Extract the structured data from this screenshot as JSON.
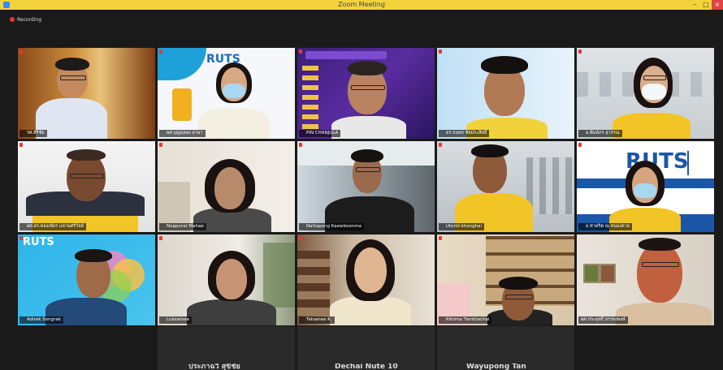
{
  "window": {
    "title": "Zoom Meeting",
    "minimize": "–",
    "maximize": "□",
    "close": "×"
  },
  "recording": {
    "label": "Recording"
  },
  "participants": [
    {
      "name": "รศ.ศิริชัย",
      "muted": true
    },
    {
      "name": "ผศ.บุญฉลอง อาษา",
      "muted": true
    },
    {
      "name": "PIN CHANJULA",
      "muted": true
    },
    {
      "name": "ดร.ธนพร ชัยประสิทธิ์",
      "muted": true
    },
    {
      "name": "อ.พิมพ์ภร สุวรรณ",
      "muted": true
    },
    {
      "name": "ผศ.ดร.ทองเพียร แหวนศรีวัลย์",
      "muted": true
    },
    {
      "name": "Nopporat Mahae",
      "muted": true
    },
    {
      "name": "Nattapong Kaewboonma",
      "muted": true
    },
    {
      "name": "Utorid khonghai",
      "muted": true
    },
    {
      "name": "อ.ชาคริต ณ หนองคาย",
      "muted": true
    },
    {
      "name": "Adirek Songrak",
      "muted": true
    },
    {
      "name": "Luksamee",
      "muted": true
    },
    {
      "name": "Tatsanee K.",
      "muted": true
    },
    {
      "name": "Kittima Tianthachai",
      "muted": true
    },
    {
      "name": "ผศ.ประยุทธิ์ ยรรยงพงษ์",
      "muted": false,
      "active": true
    }
  ],
  "bottom_row": [
    "ประภาฉวี สุขีชัย",
    "Dechai Nute 10",
    "Wayupong Tan"
  ],
  "logos": {
    "ruts": "RUTS"
  },
  "colors": {
    "titlebar": "#f3d33c",
    "active_border": "#f2e05a",
    "muted_icon": "#e53935"
  }
}
